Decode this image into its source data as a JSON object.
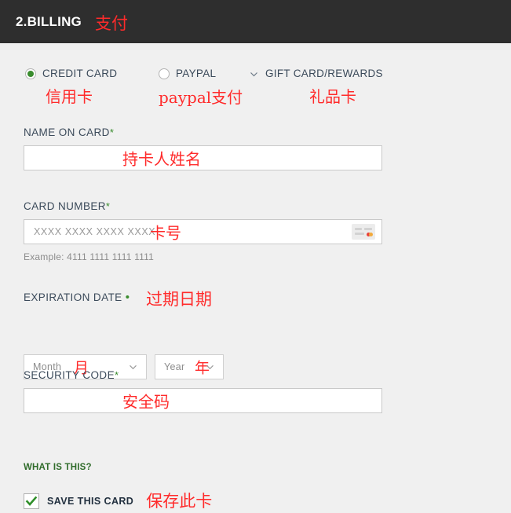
{
  "header": {
    "step_title": "2.BILLING",
    "annotation": "支付",
    "background": "#2e2e2e",
    "text_color": "#ffffff",
    "annotation_color": "#ff2b2b"
  },
  "theme": {
    "page_background": "#f0f0f0",
    "accent_green": "#3a8c2e",
    "link_green": "#2f6b2a",
    "label_color": "#3b4a5a",
    "annotation_red": "#ff2b2b",
    "input_border": "#c9c9c9"
  },
  "payment_methods": {
    "options": [
      {
        "id": "credit-card",
        "label": "CREDIT CARD",
        "annotation": "信用卡",
        "control": "radio",
        "selected": true
      },
      {
        "id": "paypal",
        "label": "PAYPAL",
        "annotation": "paypal支付",
        "control": "radio",
        "selected": false
      },
      {
        "id": "gift-card-rewards",
        "label": "GIFT CARD/REWARDS",
        "annotation": "礼品卡",
        "control": "chevron-down",
        "selected": false
      }
    ]
  },
  "form": {
    "name_on_card": {
      "label": "NAME ON CARD",
      "required_marker": "*",
      "value": "",
      "placeholder": "",
      "annotation": "持卡人姓名"
    },
    "card_number": {
      "label": "CARD NUMBER",
      "required_marker": "*",
      "value": "",
      "placeholder": "XXXX XXXX XXXX XXXX",
      "annotation": "卡号",
      "helper": "Example: 4111 1111 1111 1111",
      "card_icon": "credit-card-icon"
    },
    "expiration_date": {
      "label": "EXPIRATION DATE",
      "required_marker": "•",
      "annotation": "过期日期",
      "month": {
        "selected": "Month",
        "annotation": "月"
      },
      "year": {
        "selected": "Year",
        "annotation": "年"
      }
    },
    "security_code": {
      "label": "SECURITY CODE",
      "required_marker": "*",
      "value": "",
      "placeholder": "",
      "annotation": "安全码",
      "help_link": "WHAT IS THIS?"
    },
    "save_this_card": {
      "label": "SAVE THIS CARD",
      "annotation": "保存此卡",
      "checked": true
    }
  }
}
